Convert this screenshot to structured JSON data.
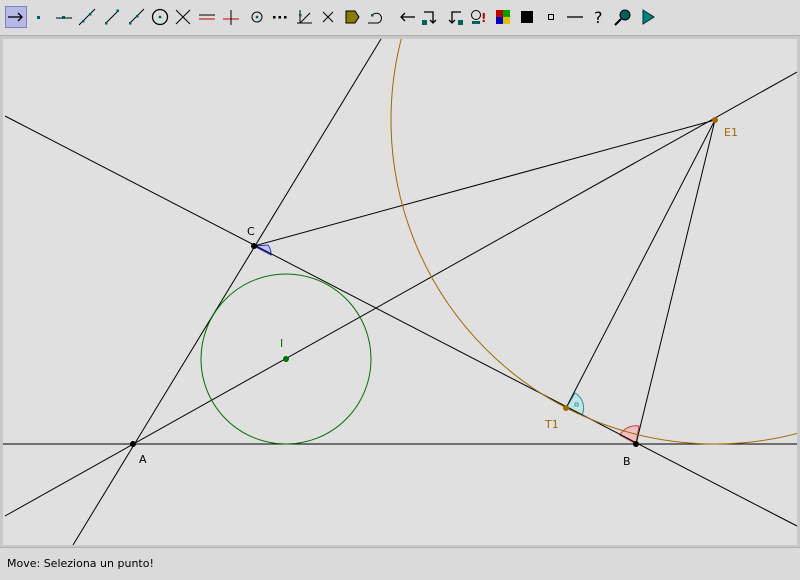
{
  "toolbar": {
    "tools": [
      {
        "name": "move-tool",
        "icon": "arrow-right-icon",
        "selected": true
      },
      {
        "name": "point-tool",
        "icon": "point-icon"
      },
      {
        "name": "point-on-line-tool",
        "icon": "point-on-object-icon"
      },
      {
        "name": "line-tool",
        "icon": "line-icon"
      },
      {
        "name": "segment-tool",
        "icon": "segment-icon"
      },
      {
        "name": "ray-tool",
        "icon": "ray-icon"
      },
      {
        "name": "circle-tool",
        "icon": "circle-icon"
      },
      {
        "name": "intersection-tool",
        "icon": "intersection-icon"
      },
      {
        "name": "parallel-tool",
        "icon": "parallel-icon"
      },
      {
        "name": "perpendicular-tool",
        "icon": "perpendicular-icon"
      },
      {
        "name": "midpoint-tool",
        "icon": "midpoint-icon"
      },
      {
        "name": "dotted-line-tool",
        "icon": "dotted-line-icon"
      },
      {
        "name": "angle-tool",
        "icon": "angle-icon"
      },
      {
        "name": "delete-tool",
        "icon": "delete-icon"
      },
      {
        "name": "fill-tool",
        "icon": "fill-shape-icon"
      },
      {
        "name": "locus-tool",
        "icon": "locus-icon"
      },
      {
        "name": "undo-tool",
        "icon": "arrow-left-icon"
      },
      {
        "name": "macro-in-tool",
        "icon": "macro-in-icon"
      },
      {
        "name": "macro-out-tool",
        "icon": "macro-out-icon"
      },
      {
        "name": "check-tool",
        "icon": "check-icon",
        "text": "!"
      },
      {
        "name": "color-tool",
        "icon": "color-palette-icon"
      },
      {
        "name": "thickness-tool",
        "icon": "filled-square-icon"
      },
      {
        "name": "point-style-tool",
        "icon": "small-square-icon"
      },
      {
        "name": "line-style-tool",
        "icon": "line-style-icon"
      },
      {
        "name": "help-tool",
        "icon": "question-icon",
        "text": "?"
      },
      {
        "name": "zoom-tool",
        "icon": "zoom-icon"
      },
      {
        "name": "animate-tool",
        "icon": "play-icon"
      }
    ]
  },
  "canvas": {
    "background": "#e0e0e0",
    "points": [
      {
        "id": "A",
        "label": "A",
        "color": "#000000"
      },
      {
        "id": "B",
        "label": "B",
        "color": "#000000"
      },
      {
        "id": "C",
        "label": "C",
        "color": "#000000"
      },
      {
        "id": "I",
        "label": "I",
        "color": "#007000"
      },
      {
        "id": "E1",
        "label": "E1",
        "color": "#a06a00"
      },
      {
        "id": "T1",
        "label": "T1",
        "color": "#a06a00"
      }
    ],
    "colors": {
      "line": "#000000",
      "incircle": "#007000",
      "excircle": "#a06a00",
      "angle_c": "#c0c0ff",
      "angle_t1": "#c0e4e4",
      "angle_b": "#f0c0c0"
    }
  },
  "status": {
    "text": "Move: Seleziona un punto!"
  }
}
